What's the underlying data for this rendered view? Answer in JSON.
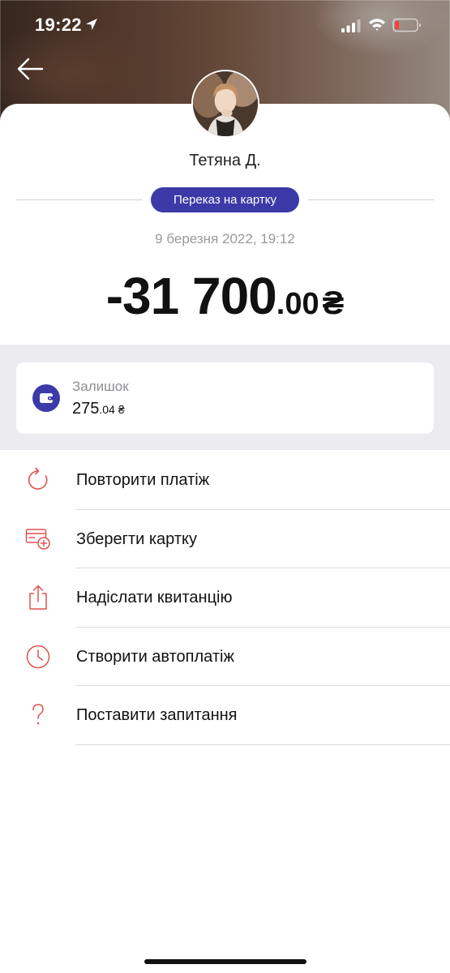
{
  "status_bar": {
    "time": "19:22",
    "icons": [
      "location-arrow-icon",
      "cellular-signal-icon",
      "wifi-icon",
      "battery-low-icon"
    ]
  },
  "header": {
    "back_icon": "arrow-left-icon"
  },
  "contact": {
    "name": "Тетяна Д."
  },
  "transaction": {
    "category": "Переказ на картку",
    "date": "9 березня 2022, 19:12",
    "amount_integer": "-31 700",
    "amount_decimal": ".00",
    "currency": "₴"
  },
  "balance": {
    "label": "Залишок",
    "integer": "275",
    "decimal": ".04",
    "currency": "₴",
    "icon": "wallet-icon"
  },
  "actions": [
    {
      "label": "Повторити платіж",
      "icon": "repeat-icon"
    },
    {
      "label": "Зберегти картку",
      "icon": "save-card-icon"
    },
    {
      "label": "Надіслати квитанцію",
      "icon": "share-icon"
    },
    {
      "label": "Створити автоплатіж",
      "icon": "clock-icon"
    },
    {
      "label": "Поставити запитання",
      "icon": "question-icon"
    }
  ],
  "colors": {
    "accent": "#3b3aa8",
    "action_icon": "#e0524f",
    "battery_low": "#ff3b30"
  }
}
